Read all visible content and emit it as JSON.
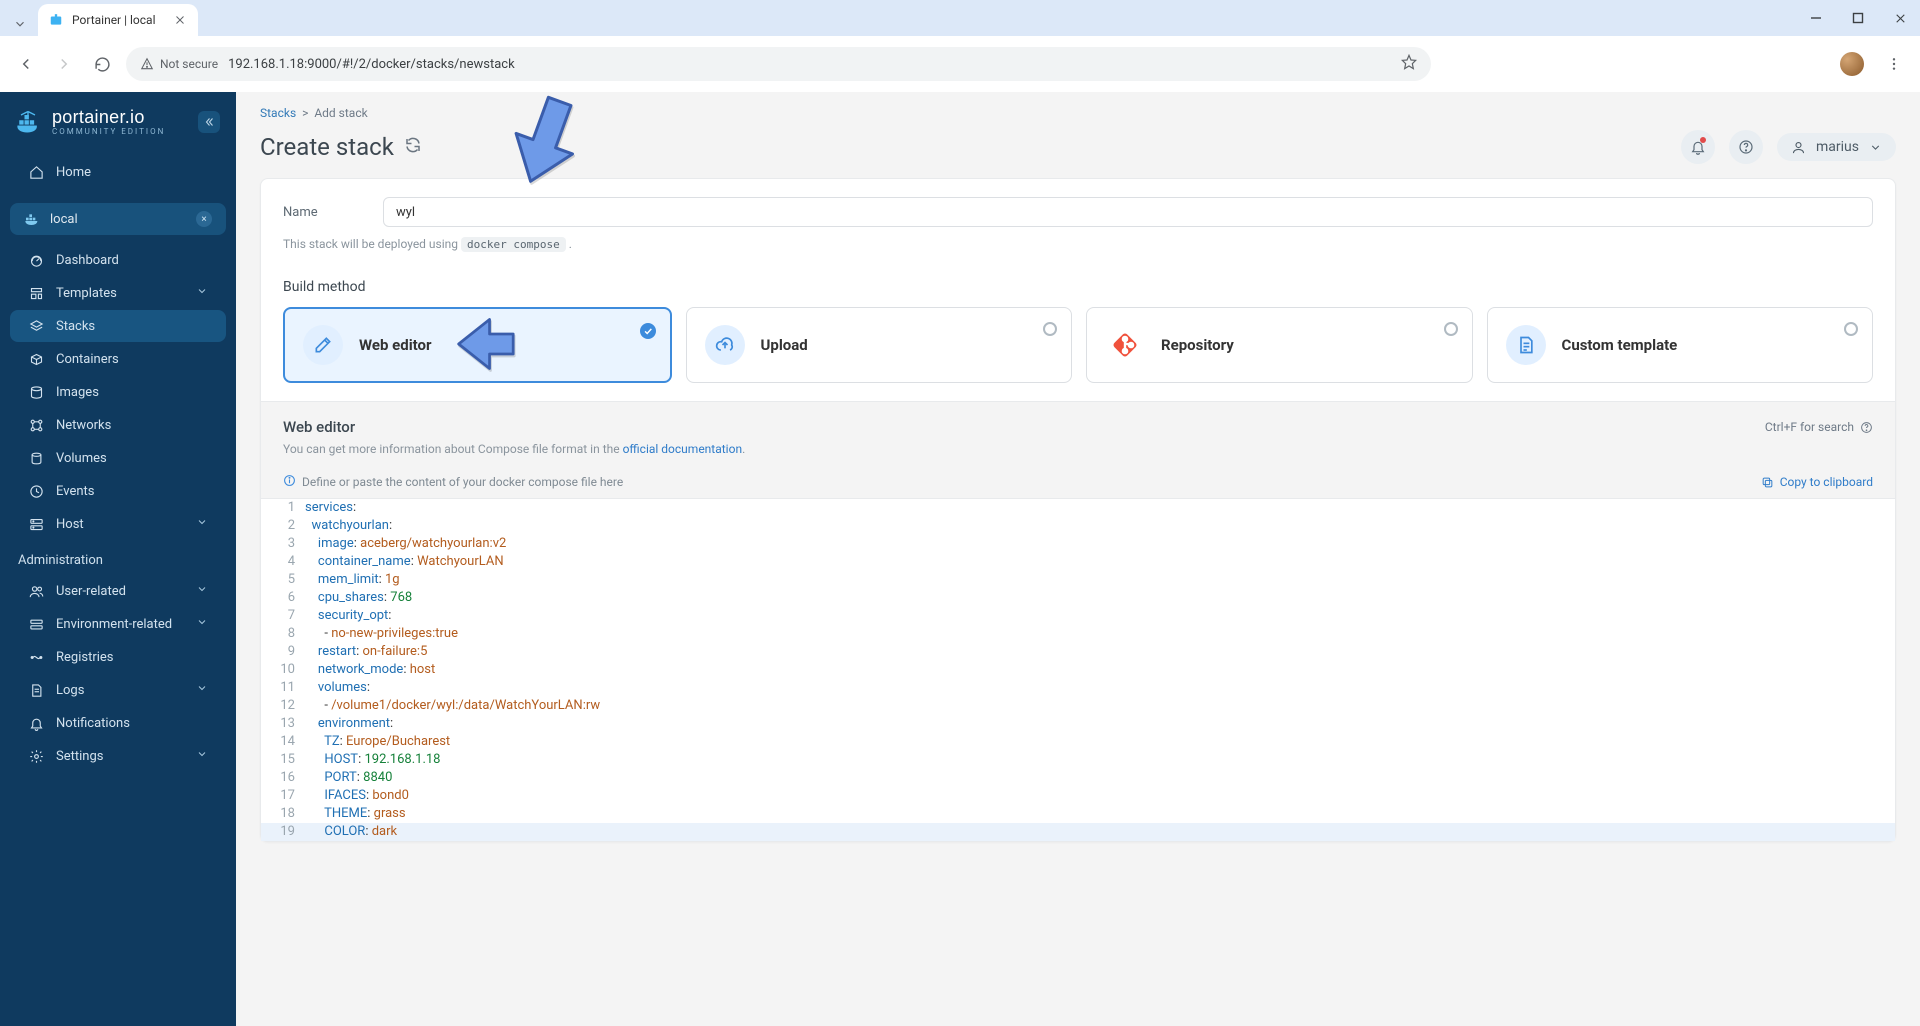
{
  "browser": {
    "tab_title": "Portainer | local",
    "not_secure": "Not secure",
    "url": "192.168.1.18:9000/#!/2/docker/stacks/newstack"
  },
  "brand": {
    "name": "portainer.io",
    "sub": "COMMUNITY EDITION"
  },
  "sidebar": {
    "home": "Home",
    "env": "local",
    "items": [
      {
        "label": "Dashboard"
      },
      {
        "label": "Templates"
      },
      {
        "label": "Stacks"
      },
      {
        "label": "Containers"
      },
      {
        "label": "Images"
      },
      {
        "label": "Networks"
      },
      {
        "label": "Volumes"
      },
      {
        "label": "Events"
      },
      {
        "label": "Host"
      }
    ],
    "admin_label": "Administration",
    "admin_items": [
      {
        "label": "User-related"
      },
      {
        "label": "Environment-related"
      },
      {
        "label": "Registries"
      },
      {
        "label": "Logs"
      },
      {
        "label": "Notifications"
      },
      {
        "label": "Settings"
      }
    ]
  },
  "header": {
    "crumb_root": "Stacks",
    "crumb_sep": ">",
    "crumb_leaf": "Add stack",
    "title": "Create stack",
    "user": "marius"
  },
  "form": {
    "name_label": "Name",
    "name_value": "wyl",
    "deploy_prefix": "This stack will be deployed using ",
    "deploy_tool": "docker compose",
    "deploy_suffix": " .",
    "build_title": "Build method",
    "methods": [
      {
        "label": "Web editor"
      },
      {
        "label": "Upload"
      },
      {
        "label": "Repository"
      },
      {
        "label": "Custom template"
      }
    ]
  },
  "editor": {
    "title": "Web editor",
    "search_hint": "Ctrl+F for search",
    "sub_prefix": "You can get more information about Compose file format in the ",
    "sub_link": "official documentation",
    "sub_suffix": ".",
    "placeholder": "Define or paste the content of your docker compose file here",
    "copy_label": "Copy to clipboard"
  },
  "code_lines": [
    {
      "n": "1",
      "html": "<span class='tok-key'>services</span><span class='tok-punc'>:</span>"
    },
    {
      "n": "2",
      "html": "  <span class='tok-key'>watchyourlan</span><span class='tok-punc'>:</span>"
    },
    {
      "n": "3",
      "html": "    <span class='tok-key'>image</span><span class='tok-punc'>:</span> <span class='tok-str'>aceberg/watchyourlan:v2</span>"
    },
    {
      "n": "4",
      "html": "    <span class='tok-key'>container_name</span><span class='tok-punc'>:</span> <span class='tok-str'>WatchyourLAN</span>"
    },
    {
      "n": "5",
      "html": "    <span class='tok-key'>mem_limit</span><span class='tok-punc'>:</span> <span class='tok-str'>1g</span>"
    },
    {
      "n": "6",
      "html": "    <span class='tok-key'>cpu_shares</span><span class='tok-punc'>:</span> <span class='tok-num'>768</span>"
    },
    {
      "n": "7",
      "html": "    <span class='tok-key'>security_opt</span><span class='tok-punc'>:</span>"
    },
    {
      "n": "8",
      "html": "      <span class='tok-punc'>-</span> <span class='tok-str'>no-new-privileges:true</span>"
    },
    {
      "n": "9",
      "html": "    <span class='tok-key'>restart</span><span class='tok-punc'>:</span> <span class='tok-str'>on-failure:5</span>"
    },
    {
      "n": "10",
      "html": "    <span class='tok-key'>network_mode</span><span class='tok-punc'>:</span> <span class='tok-str'>host</span>"
    },
    {
      "n": "11",
      "html": "    <span class='tok-key'>volumes</span><span class='tok-punc'>:</span>"
    },
    {
      "n": "12",
      "html": "      <span class='tok-punc'>-</span> <span class='tok-str'>/volume1/docker/wyl:/data/WatchYourLAN:rw</span>"
    },
    {
      "n": "13",
      "html": "    <span class='tok-key'>environment</span><span class='tok-punc'>:</span>"
    },
    {
      "n": "14",
      "html": "      <span class='tok-key'>TZ</span><span class='tok-punc'>:</span> <span class='tok-str'>Europe/Bucharest</span>"
    },
    {
      "n": "15",
      "html": "      <span class='tok-key'>HOST</span><span class='tok-punc'>:</span> <span class='tok-num'>192.168.1.18</span>"
    },
    {
      "n": "16",
      "html": "      <span class='tok-key'>PORT</span><span class='tok-punc'>:</span> <span class='tok-num'>8840</span>"
    },
    {
      "n": "17",
      "html": "      <span class='tok-key'>IFACES</span><span class='tok-punc'>:</span> <span class='tok-str'>bond0</span>"
    },
    {
      "n": "18",
      "html": "      <span class='tok-key'>THEME</span><span class='tok-punc'>:</span> <span class='tok-str'>grass</span>"
    },
    {
      "n": "19",
      "html": "      <span class='tok-key'>COLOR</span><span class='tok-punc'>:</span> <span class='tok-str'>dark</span>",
      "curr": true
    }
  ]
}
